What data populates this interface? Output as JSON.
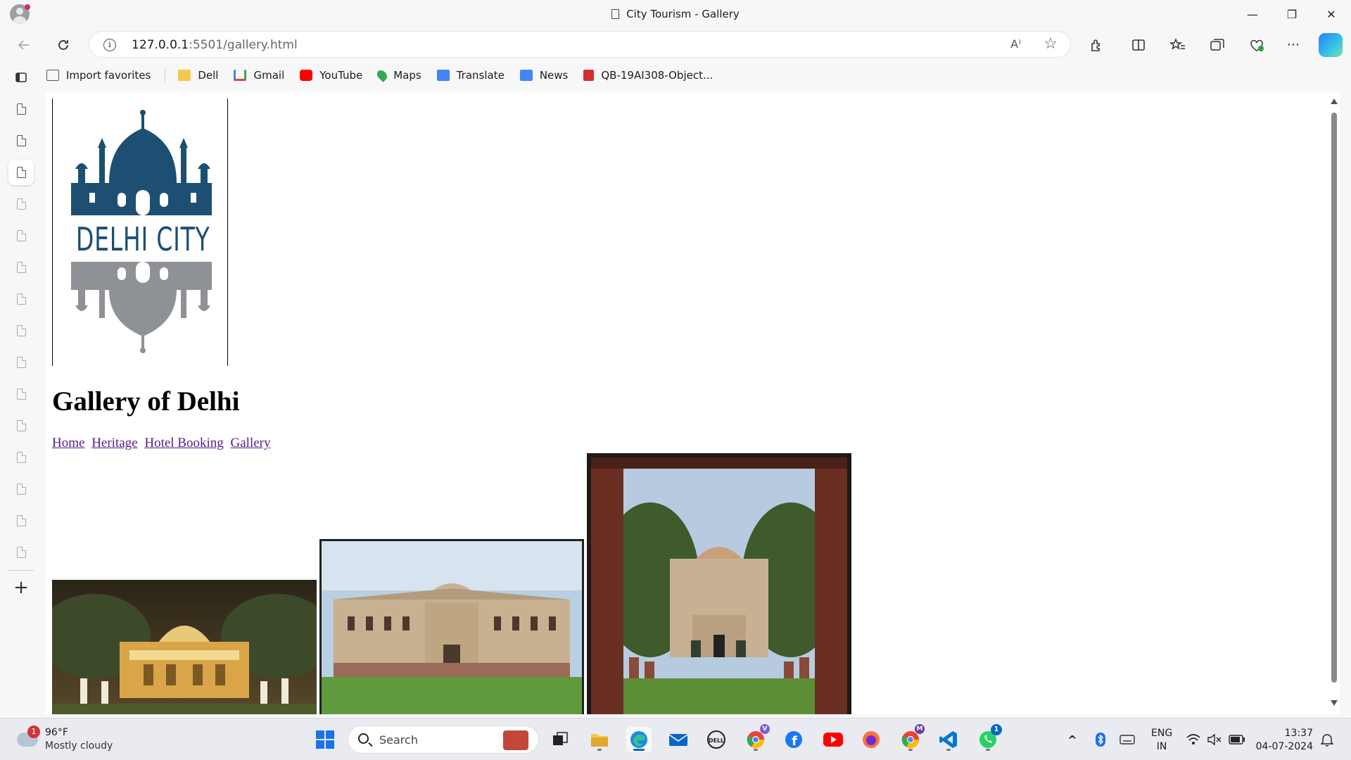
{
  "window": {
    "title": "City Tourism - Gallery",
    "controls": {
      "minimize": "—",
      "restore": "❐",
      "close": "✕"
    }
  },
  "addressbar": {
    "url_host": "127.0.0.1",
    "url_rest": ":5501/gallery.html",
    "read_aloud": "A⁾",
    "favorite": "☆"
  },
  "favorites": [
    {
      "label": "Import favorites",
      "icon": "import-icon",
      "color": "#555555"
    },
    {
      "label": "Dell",
      "icon": "folder-icon",
      "color": "#f2c94c"
    },
    {
      "label": "Gmail",
      "icon": "gmail-icon",
      "color": "#ea4335"
    },
    {
      "label": "YouTube",
      "icon": "youtube-icon",
      "color": "#ff0000"
    },
    {
      "label": "Maps",
      "icon": "maps-icon",
      "color": "#34a853"
    },
    {
      "label": "Translate",
      "icon": "translate-icon",
      "color": "#4285f4"
    },
    {
      "label": "News",
      "icon": "news-icon",
      "color": "#4285f4"
    },
    {
      "label": "QB-19AI308-Object...",
      "icon": "pdf-icon",
      "color": "#d32f2f"
    }
  ],
  "page": {
    "logo_text": "DELHI CITY",
    "heading": "Gallery of Delhi",
    "nav": [
      "Home",
      "Heritage",
      "Hotel Booking",
      "Gallery"
    ]
  },
  "taskbar": {
    "weather_temp": "96°F",
    "weather_cond": "Mostly cloudy",
    "weather_badge": "1",
    "search_placeholder": "Search",
    "lang_1": "ENG",
    "lang_2": "IN",
    "time": "13:37",
    "date": "04-07-2024",
    "whatsapp_badge": "1",
    "chrome_v_badge": "V",
    "chrome_m_badge": "M"
  },
  "colors": {
    "logo_blue": "#1c4f72",
    "logo_grey": "#8e9195",
    "link_visited": "#551a8b"
  }
}
